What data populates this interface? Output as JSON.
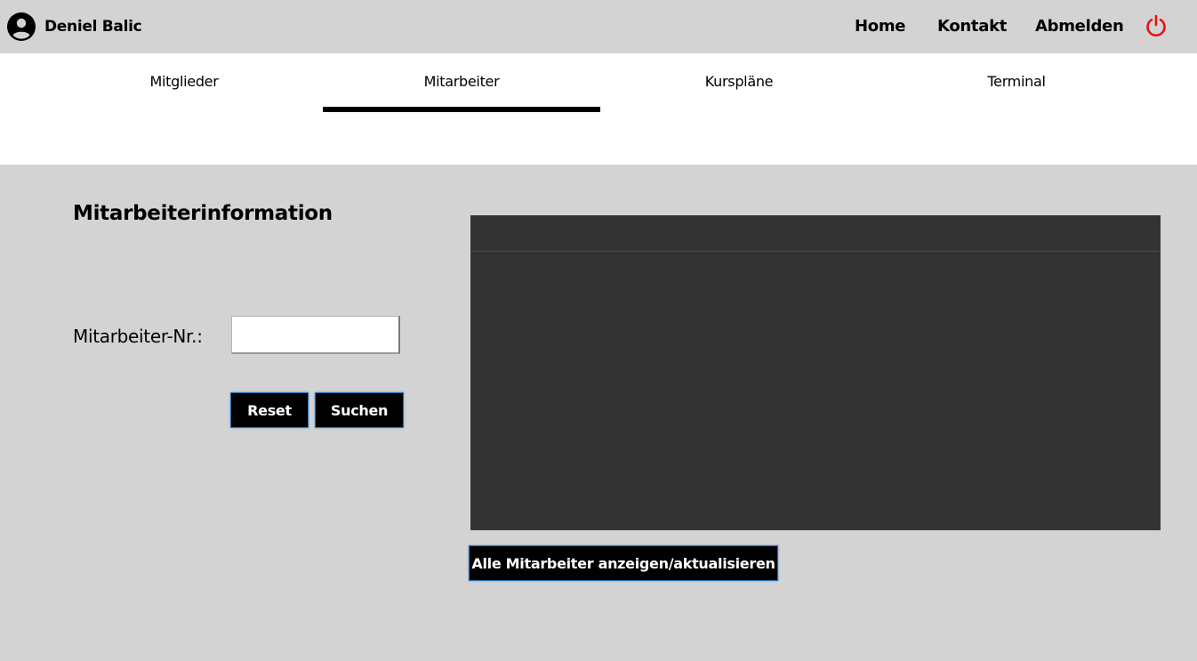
{
  "header": {
    "user_name": "Deniel Balic",
    "user_icon": "account-circle-icon",
    "nav": [
      {
        "label": "Home"
      },
      {
        "label": "Kontakt"
      },
      {
        "label": "Abmelden"
      }
    ],
    "power_icon": "power-icon",
    "power_color": "#e0151b"
  },
  "tabs": [
    {
      "label": "Mitglieder",
      "active": false
    },
    {
      "label": "Mitarbeiter",
      "active": true
    },
    {
      "label": "Kurspläne",
      "active": false
    },
    {
      "label": "Terminal",
      "active": false
    }
  ],
  "main": {
    "section_title": "Mitarbeiterinformation",
    "employee_number": {
      "label": "Mitarbeiter-Nr.:",
      "value": ""
    },
    "reset_label": "Reset",
    "search_label": "Suchen",
    "show_all_label": "Alle Mitarbeiter anzeigen/aktualisieren"
  },
  "colors": {
    "background": "#d3d3d3",
    "tabbar": "#ffffff",
    "grid": "#333333",
    "button": "#000000"
  }
}
